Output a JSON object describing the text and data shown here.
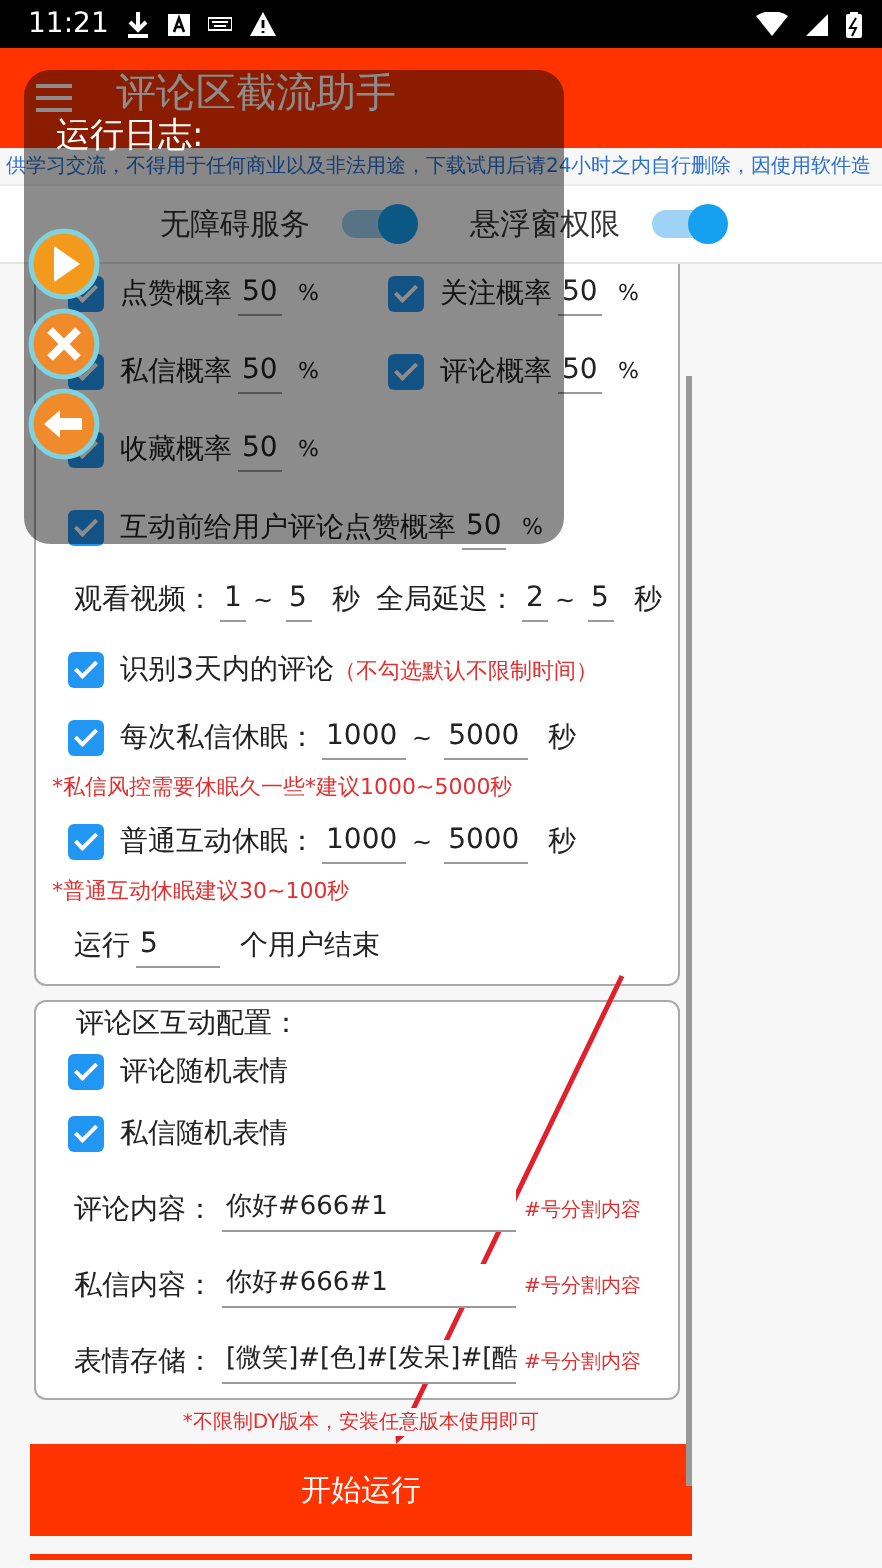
{
  "status_bar": {
    "time": "11:21"
  },
  "header": {
    "title": "评论区截流助手"
  },
  "notice": "供学习交流，不得用于任何商业以及非法用途，下载试用后请24小时之内自行删除，因使用软件造",
  "permissions": [
    {
      "label": "无障碍服务",
      "on": true
    },
    {
      "label": "悬浮窗权限",
      "on": true
    }
  ],
  "probabilities": [
    {
      "kind": "half",
      "label": "点赞概率",
      "checked": true,
      "value": "50",
      "unit": "%"
    },
    {
      "kind": "half",
      "label": "关注概率",
      "checked": true,
      "value": "50",
      "unit": "%"
    },
    {
      "kind": "half",
      "label": "私信概率",
      "checked": true,
      "value": "50",
      "unit": "%"
    },
    {
      "kind": "half",
      "label": "评论概率",
      "checked": true,
      "value": "50",
      "unit": "%"
    },
    {
      "kind": "half",
      "label": "收藏概率",
      "checked": true,
      "value": "50",
      "unit": "%"
    },
    {
      "kind": "wide",
      "label": "互动前给用户评论点赞概率",
      "checked": true,
      "value": "50",
      "unit": "%"
    }
  ],
  "ranges": [
    {
      "label": "观看视频：",
      "from": "1",
      "separator": "~",
      "to": "5",
      "unit": "秒"
    },
    {
      "label": "全局延迟：",
      "from": "2",
      "separator": "~",
      "to": "5",
      "unit": "秒"
    }
  ],
  "recent_filter": {
    "label": "识别3天内的评论",
    "checked": true,
    "hint": "（不勾选默认不限制时间）"
  },
  "sleeps": [
    {
      "label": "每次私信休眠：",
      "checked": true,
      "from": "1000",
      "separator": "~",
      "to": "5000",
      "unit": "秒",
      "note": "*私信风控需要休眠久一些*建议1000~5000秒"
    },
    {
      "label": "普通互动休眠：",
      "checked": true,
      "from": "1000",
      "separator": "~",
      "to": "5000",
      "unit": "秒",
      "note": "*普通互动休眠建议30~100秒"
    }
  ],
  "run_limit": {
    "prefix": "运行",
    "value": "5",
    "suffix": "个用户结束"
  },
  "comment_config": {
    "title": "评论区互动配置：",
    "options": [
      {
        "label": "评论随机表情",
        "checked": true
      },
      {
        "label": "私信随机表情",
        "checked": true
      }
    ],
    "fields": [
      {
        "label": "评论内容：",
        "value": "你好#666#1",
        "hint": "#号分割内容"
      },
      {
        "label": "私信内容：",
        "value": "你好#666#1",
        "hint": "#号分割内容"
      },
      {
        "label": "表情存储：",
        "value": "[微笑]#[色]#[发呆]#[酷",
        "hint": "#号分割内容"
      }
    ]
  },
  "footer_note": "*不限制DY版本，安装任意版本使用即可",
  "start_button": "开始运行",
  "log_panel": {
    "title": "运行日志:",
    "buttons": [
      {
        "kind": "play"
      },
      {
        "kind": "close"
      },
      {
        "kind": "back"
      }
    ]
  }
}
